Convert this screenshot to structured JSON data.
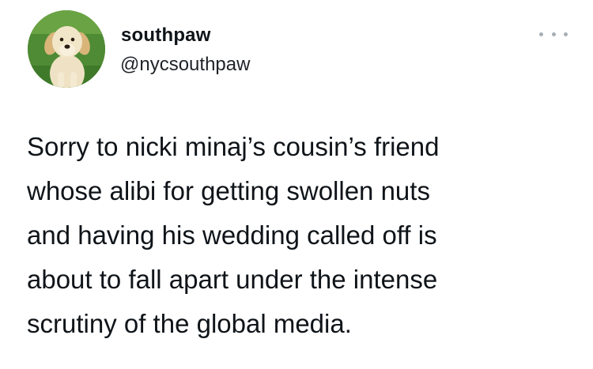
{
  "tweet": {
    "author": {
      "display_name": "southpaw",
      "handle": "@nycsouthpaw",
      "avatar_icon": "golden-retriever-puppy-avatar"
    },
    "more_icon": "more-options-icon",
    "text_lines": [
      "Sorry to nicki minaj’s cousin’s friend",
      "whose alibi for getting swollen nuts",
      "and having his wedding called off is",
      "about to fall apart under the intense",
      "scrutiny of the global media."
    ]
  }
}
